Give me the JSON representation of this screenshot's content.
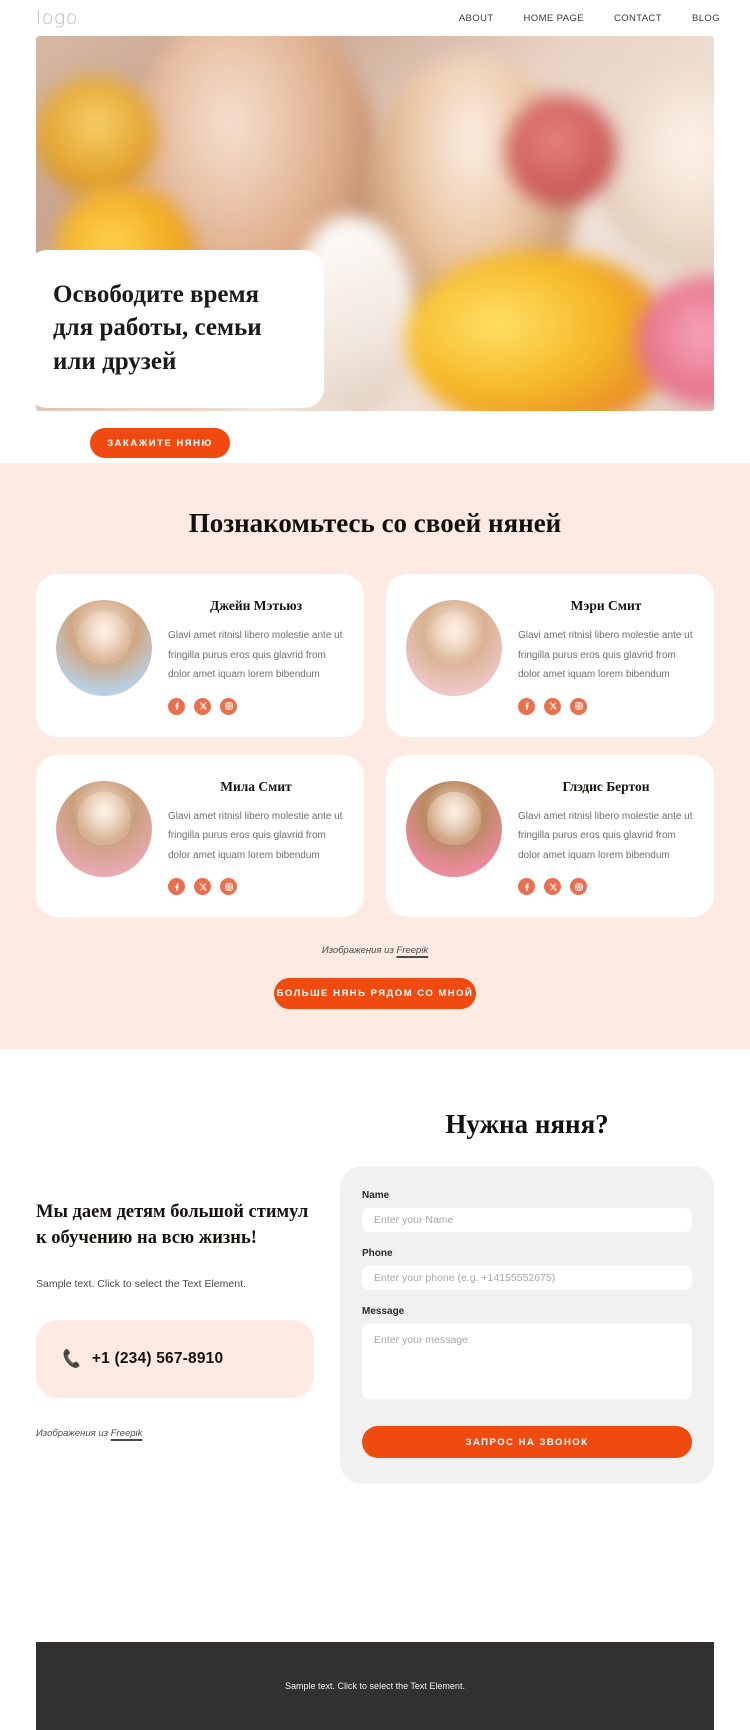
{
  "header": {
    "logo": "logo",
    "nav": [
      {
        "label": "ABOUT"
      },
      {
        "label": "HOME PAGE"
      },
      {
        "label": "CONTACT"
      },
      {
        "label": "BLOG"
      }
    ]
  },
  "hero": {
    "title": "Освободите время для работы, семьи или друзей",
    "cta_label": "ЗАКАЖИТЕ НЯНЮ"
  },
  "nannies": {
    "section_title": "Познакомьтесь со своей няней",
    "description": "Glavi amet ritnisl libero molestie ante ut fringilla purus eros quis glavrid from dolor amet iquam lorem bibendum",
    "cards": [
      {
        "name": "Джейн Мэтьюз"
      },
      {
        "name": "Мэри Смит"
      },
      {
        "name": "Мила Смит"
      },
      {
        "name": "Глэдис Бертон"
      }
    ],
    "socials": [
      {
        "name": "facebook"
      },
      {
        "name": "x-twitter"
      },
      {
        "name": "instagram"
      }
    ],
    "credit_prefix": "Изображения из ",
    "credit_link": "Freepik",
    "more_label": "БОЛЬШЕ НЯНЬ РЯДОМ СО МНОЙ"
  },
  "contact": {
    "heading": "Мы даем детям большой стимул к обучению на всю жизнь!",
    "sample_text": "Sample text. Click to select the Text Element.",
    "phone": "+1 (234) 567-8910",
    "credit_prefix": "Изображения из ",
    "credit_link": "Freepik",
    "form_title": "Нужна няня?",
    "form": {
      "name_label": "Name",
      "name_placeholder": "Enter your Name",
      "name_value": "",
      "phone_label": "Phone",
      "phone_placeholder": "Enter your phone (e.g. +14155552675)",
      "phone_value": "",
      "message_label": "Message",
      "message_placeholder": "Enter your message",
      "message_value": "",
      "submit_label": "ЗАПРОС НА ЗВОНОК"
    }
  },
  "footer": {
    "text": "Sample text. Click to select the Text Element."
  },
  "colors": {
    "accent": "#ef4a0f",
    "social": "#e9704f",
    "section_bg": "#fdeae2",
    "footer_bg": "#333030",
    "form_bg": "#f1f1f1"
  }
}
